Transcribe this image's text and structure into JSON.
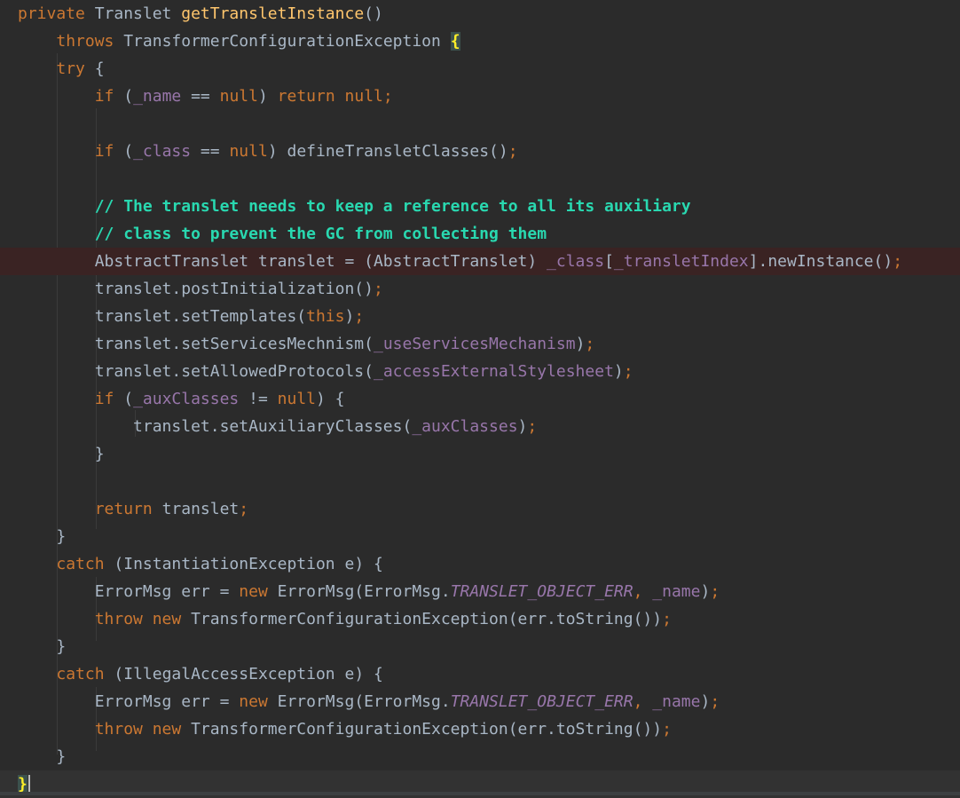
{
  "lines": [
    [
      [
        "kw",
        "private "
      ],
      [
        "",
        "Translet "
      ],
      [
        "fn",
        "getTransletInstance"
      ],
      [
        "",
        "()"
      ]
    ],
    [
      [
        "",
        "    "
      ],
      [
        "kw",
        "throws "
      ],
      [
        "",
        "TransformerConfigurationException "
      ],
      [
        "brace",
        "{"
      ]
    ],
    [
      [
        "",
        "    "
      ],
      [
        "kw",
        "try "
      ],
      [
        "",
        "{"
      ]
    ],
    [
      [
        "",
        "        "
      ],
      [
        "kw",
        "if "
      ],
      [
        "",
        "("
      ],
      [
        "field",
        "_name"
      ],
      [
        "",
        " == "
      ],
      [
        "kw",
        "null"
      ],
      [
        "",
        ") "
      ],
      [
        "kw",
        "return null;"
      ]
    ],
    [],
    [
      [
        "",
        "        "
      ],
      [
        "kw",
        "if "
      ],
      [
        "",
        "("
      ],
      [
        "field",
        "_class"
      ],
      [
        "",
        " == "
      ],
      [
        "kw",
        "null"
      ],
      [
        "",
        ") defineTransletClasses()"
      ],
      [
        "kw",
        ";"
      ]
    ],
    [],
    [
      [
        "",
        "        "
      ],
      [
        "cmt",
        "// The translet needs to keep a reference to all its auxiliary"
      ]
    ],
    [
      [
        "",
        "        "
      ],
      [
        "cmt",
        "// class to prevent the GC from collecting them"
      ]
    ],
    [
      [
        "",
        "        "
      ],
      [
        "",
        "AbstractTranslet translet = (AbstractTranslet) "
      ],
      [
        "field",
        "_class"
      ],
      [
        "",
        "["
      ],
      [
        "field",
        "_transletIndex"
      ],
      [
        "",
        "].newInstance()"
      ],
      [
        "kw",
        ";"
      ]
    ],
    [
      [
        "",
        "        "
      ],
      [
        "",
        "translet.postInitialization()"
      ],
      [
        "kw",
        ";"
      ]
    ],
    [
      [
        "",
        "        "
      ],
      [
        "",
        "translet.setTemplates("
      ],
      [
        "kw",
        "this"
      ],
      [
        "",
        ")"
      ],
      [
        "kw",
        ";"
      ]
    ],
    [
      [
        "",
        "        "
      ],
      [
        "",
        "translet.setServicesMechnism("
      ],
      [
        "field",
        "_useServicesMechanism"
      ],
      [
        "",
        ")"
      ],
      [
        "kw",
        ";"
      ]
    ],
    [
      [
        "",
        "        "
      ],
      [
        "",
        "translet.setAllowedProtocols("
      ],
      [
        "field",
        "_accessExternalStylesheet"
      ],
      [
        "",
        ")"
      ],
      [
        "kw",
        ";"
      ]
    ],
    [
      [
        "",
        "        "
      ],
      [
        "kw",
        "if "
      ],
      [
        "",
        "("
      ],
      [
        "field",
        "_auxClasses"
      ],
      [
        "",
        " != "
      ],
      [
        "kw",
        "null"
      ],
      [
        "",
        ") {"
      ]
    ],
    [
      [
        "",
        "            "
      ],
      [
        "",
        "translet.setAuxiliaryClasses("
      ],
      [
        "field",
        "_auxClasses"
      ],
      [
        "",
        ")"
      ],
      [
        "kw",
        ";"
      ]
    ],
    [
      [
        "",
        "        "
      ],
      [
        "",
        "}"
      ]
    ],
    [],
    [
      [
        "",
        "        "
      ],
      [
        "kw",
        "return "
      ],
      [
        "",
        "translet"
      ],
      [
        "kw",
        ";"
      ]
    ],
    [
      [
        "",
        "    "
      ],
      [
        "",
        "}"
      ]
    ],
    [
      [
        "",
        "    "
      ],
      [
        "kw",
        "catch "
      ],
      [
        "",
        "(InstantiationException e) {"
      ]
    ],
    [
      [
        "",
        "        "
      ],
      [
        "",
        "ErrorMsg err = "
      ],
      [
        "kw",
        "new "
      ],
      [
        "",
        "ErrorMsg(ErrorMsg."
      ],
      [
        "const",
        "TRANSLET_OBJECT_ERR"
      ],
      [
        "kw",
        ", "
      ],
      [
        "field",
        "_name"
      ],
      [
        "",
        ")"
      ],
      [
        "kw",
        ";"
      ]
    ],
    [
      [
        "",
        "        "
      ],
      [
        "kw",
        "throw new "
      ],
      [
        "",
        "TransformerConfigurationException(err.toString())"
      ],
      [
        "kw",
        ";"
      ]
    ],
    [
      [
        "",
        "    "
      ],
      [
        "",
        "}"
      ]
    ],
    [
      [
        "",
        "    "
      ],
      [
        "kw",
        "catch "
      ],
      [
        "",
        "(IllegalAccessException e) {"
      ]
    ],
    [
      [
        "",
        "        "
      ],
      [
        "",
        "ErrorMsg err = "
      ],
      [
        "kw",
        "new "
      ],
      [
        "",
        "ErrorMsg(ErrorMsg."
      ],
      [
        "const",
        "TRANSLET_OBJECT_ERR"
      ],
      [
        "kw",
        ", "
      ],
      [
        "field",
        "_name"
      ],
      [
        "",
        ")"
      ],
      [
        "kw",
        ";"
      ]
    ],
    [
      [
        "",
        "        "
      ],
      [
        "kw",
        "throw new "
      ],
      [
        "",
        "TransformerConfigurationException(err.toString())"
      ],
      [
        "kw",
        ";"
      ]
    ],
    [
      [
        "",
        "    "
      ],
      [
        "",
        "}"
      ]
    ],
    [
      [
        "brace",
        "}"
      ]
    ]
  ],
  "highlight_line": 9,
  "caret_line": 28
}
